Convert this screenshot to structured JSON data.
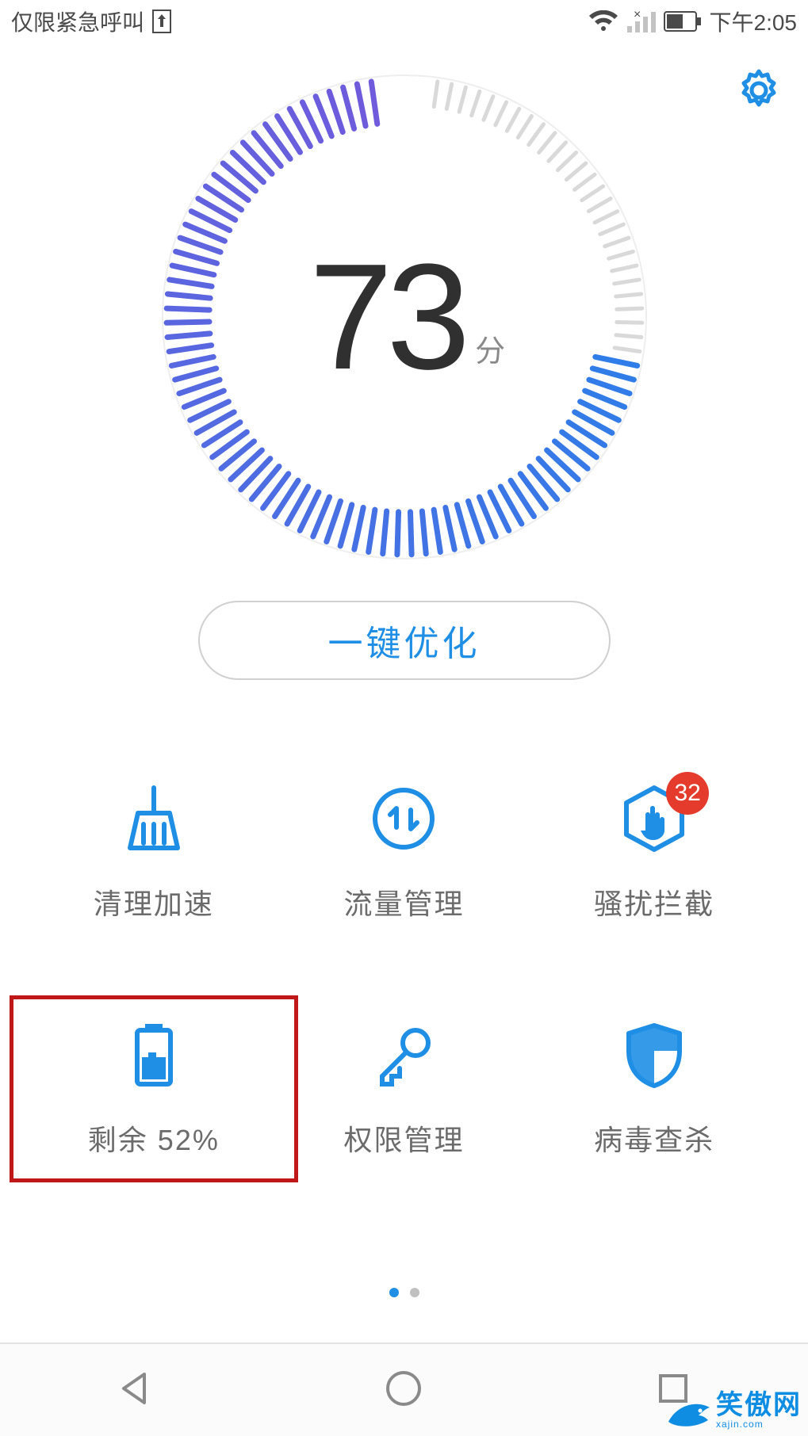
{
  "statusbar": {
    "left_text": "仅限紧急呼叫",
    "time": "下午2:05"
  },
  "score": {
    "value": "73",
    "unit": "分",
    "percent": 73
  },
  "optimize_label": "一键优化",
  "gauge_colors": {
    "inactive": "#d9d9d9",
    "active_outer": "#2f7de8",
    "active_inner": "#6f5bdc"
  },
  "tiles": [
    {
      "id": "clean",
      "label": "清理加速",
      "icon": "broom",
      "badge": null
    },
    {
      "id": "traffic",
      "label": "流量管理",
      "icon": "updown",
      "badge": null
    },
    {
      "id": "block",
      "label": "骚扰拦截",
      "icon": "hand-hex",
      "badge": "32"
    },
    {
      "id": "battery",
      "label": "剩余 52%",
      "icon": "battery",
      "badge": null
    },
    {
      "id": "perm",
      "label": "权限管理",
      "icon": "key",
      "badge": null
    },
    {
      "id": "virus",
      "label": "病毒查杀",
      "icon": "shield",
      "badge": null
    }
  ],
  "highlight_tile_index": 3,
  "watermark": {
    "text": "笑傲网",
    "sub": "xajin.com"
  },
  "brand_blue": "#1f8fe6",
  "badge_red": "#e53b2d",
  "chart_data": {
    "type": "other",
    "title": "Phone health score gauge",
    "score": 73,
    "min": 0,
    "max": 100,
    "unit": "分"
  }
}
